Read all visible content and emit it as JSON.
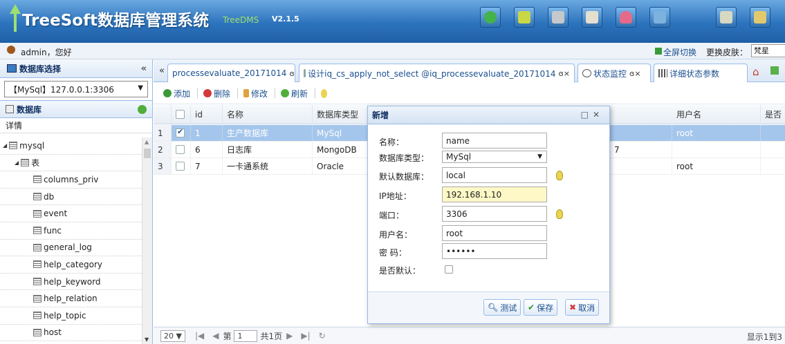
{
  "header": {
    "title": "TreeSoft数据库管理系统",
    "subtitle": "TreeDMS",
    "version": "V2.1.5",
    "buttons": [
      {
        "name": "refresh",
        "color": "#45b34b"
      },
      {
        "name": "edit",
        "color": "#c9d646"
      },
      {
        "name": "database",
        "color": "#c5c9cc"
      },
      {
        "name": "music",
        "color": "#e5dfcf"
      },
      {
        "name": "heart",
        "color": "#e56a8a"
      },
      {
        "name": "tools",
        "color": "#7cb2de"
      },
      {
        "name": "key",
        "color": "#d8d9c2"
      },
      {
        "name": "user",
        "color": "#e2c96b"
      }
    ]
  },
  "userbar": {
    "greeting": "admin，您好",
    "fullscreen": "全屏切换",
    "skin_label": "更换皮肤：",
    "skin_value": "梵星"
  },
  "sidebar": {
    "panel_title": "数据库选择",
    "collapse_glyph": "«",
    "db_select": "【MySql】127.0.0.1:3306",
    "db_header": "数据库",
    "detail": "详情",
    "tree": [
      {
        "label": "mysql",
        "level": 0,
        "expand": "◢"
      },
      {
        "label": "表",
        "level": 1,
        "expand": "◢"
      },
      {
        "label": "columns_priv",
        "level": 2
      },
      {
        "label": "db",
        "level": 2
      },
      {
        "label": "event",
        "level": 2
      },
      {
        "label": "func",
        "level": 2
      },
      {
        "label": "general_log",
        "level": 2
      },
      {
        "label": "help_category",
        "level": 2
      },
      {
        "label": "help_keyword",
        "level": 2
      },
      {
        "label": "help_relation",
        "level": 2
      },
      {
        "label": "help_topic",
        "level": 2
      },
      {
        "label": "host",
        "level": 2
      }
    ]
  },
  "tabs": {
    "scroll_left": "«",
    "items": [
      {
        "label": "processevaluate_20171014"
      },
      {
        "label": "设计iq_cs_apply_not_select @iq_processevaluate_20171014"
      },
      {
        "label": "状态监控"
      },
      {
        "label": "详细状态参数"
      }
    ],
    "close_glyph": "ɞ×"
  },
  "toolbar": {
    "add": "添加",
    "delete": "删除",
    "edit": "修改",
    "refresh": "刷新"
  },
  "grid": {
    "columns": {
      "id": "id",
      "name": "名称",
      "dbtype": "数据库类型",
      "username": "用户名",
      "isdefault": "是否"
    },
    "rows": [
      {
        "num": "1",
        "id": "1",
        "name": "生产数据库",
        "dbtype": "MySql",
        "extra": "",
        "username": "root",
        "checked": true
      },
      {
        "num": "2",
        "id": "6",
        "name": "日志库",
        "dbtype": "MongoDB",
        "extra": "7",
        "username": "",
        "checked": false
      },
      {
        "num": "3",
        "id": "7",
        "name": "一卡通系统",
        "dbtype": "Oracle",
        "extra": "",
        "username": "root",
        "checked": false
      }
    ]
  },
  "pager": {
    "page_size": "20 ▼",
    "page_prefix": "第",
    "page_value": "1",
    "page_total": "共1页",
    "summary": "显示1到3"
  },
  "dialog": {
    "title": "新增",
    "fields": {
      "name_label": "名称：",
      "name_value": "name",
      "dbtype_label": "数据库类型：",
      "dbtype_value": "MySql",
      "defaultdb_label": "默认数据库：",
      "defaultdb_value": "local",
      "ip_label": "IP地址：",
      "ip_value": "192.168.1.10",
      "port_label": "端口：",
      "port_value": "3306",
      "user_label": "用户名：",
      "user_value": "root",
      "pwd_label": "密 码：",
      "pwd_value": "••••••",
      "isdefault_label": "是否默认："
    },
    "buttons": {
      "test": "测试",
      "save": "保存",
      "cancel": "取消"
    }
  }
}
